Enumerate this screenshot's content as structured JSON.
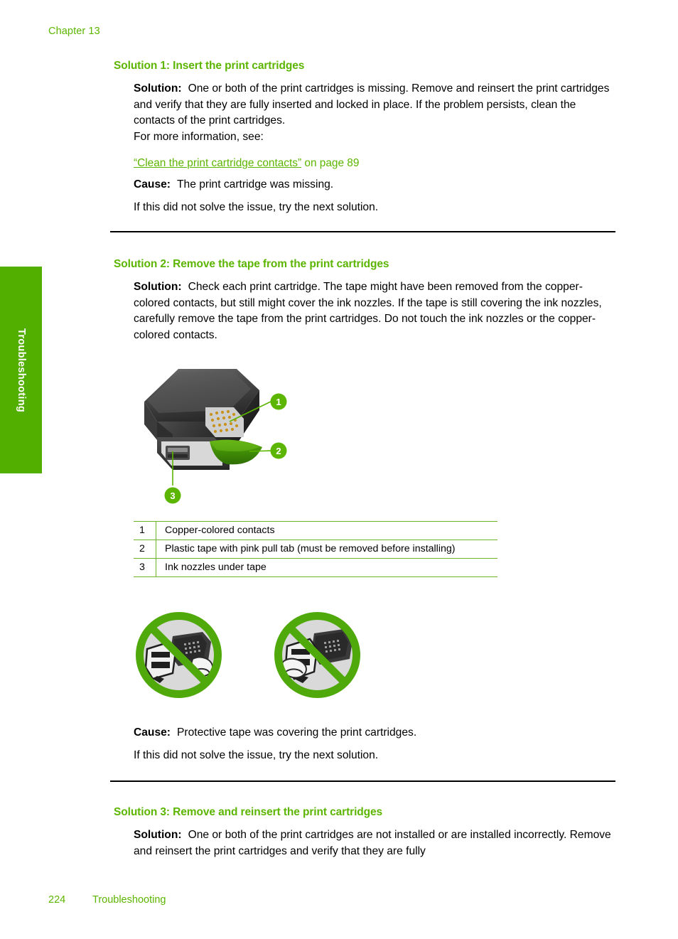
{
  "page": {
    "chapter_label": "Chapter 13",
    "side_tab_label": "Troubleshooting",
    "footer_page_number": "224",
    "footer_section": "Troubleshooting",
    "accent_green": "#5CB500",
    "tab_green": "#52AF00",
    "rule_green": "#6FB32B"
  },
  "solution1": {
    "heading": "Solution 1: Insert the print cartridges",
    "solution_label": "Solution:",
    "solution_text": "One or both of the print cartridges is missing. Remove and reinsert the print cartridges and verify that they are fully inserted and locked in place. If the problem persists, clean the contacts of the print cartridges.",
    "more_info": "For more information, see:",
    "xref_link": "“Clean the print cartridge contacts”",
    "xref_suffix": " on page 89",
    "cause_label": "Cause:",
    "cause_text": "The print cartridge was missing.",
    "next_text": "If this did not solve the issue, try the next solution."
  },
  "solution2": {
    "heading": "Solution 2: Remove the tape from the print cartridges",
    "solution_label": "Solution:",
    "solution_text": "Check each print cartridge. The tape might have been removed from the copper-colored contacts, but still might cover the ink nozzles. If the tape is still covering the ink nozzles, carefully remove the tape from the print cartridges. Do not touch the ink nozzles or the copper-colored contacts.",
    "figure": {
      "name": "print-cartridge-diagram",
      "callouts": [
        "1",
        "2",
        "3"
      ]
    },
    "legend": {
      "rows": [
        {
          "num": "1",
          "text": "Copper-colored contacts"
        },
        {
          "num": "2",
          "text": "Plastic tape with pink pull tab (must be removed before installing)"
        },
        {
          "num": "3",
          "text": "Ink nozzles under tape"
        }
      ]
    },
    "prohibition_icons": [
      "do-not-touch-copper-contacts",
      "do-not-touch-ink-nozzles"
    ],
    "cause_label": "Cause:",
    "cause_text": "Protective tape was covering the print cartridges.",
    "next_text": "If this did not solve the issue, try the next solution."
  },
  "solution3": {
    "heading": "Solution 3: Remove and reinsert the print cartridges",
    "solution_label": "Solution:",
    "solution_text": "One or both of the print cartridges are not installed or are installed incorrectly. Remove and reinsert the print cartridges and verify that they are fully"
  }
}
